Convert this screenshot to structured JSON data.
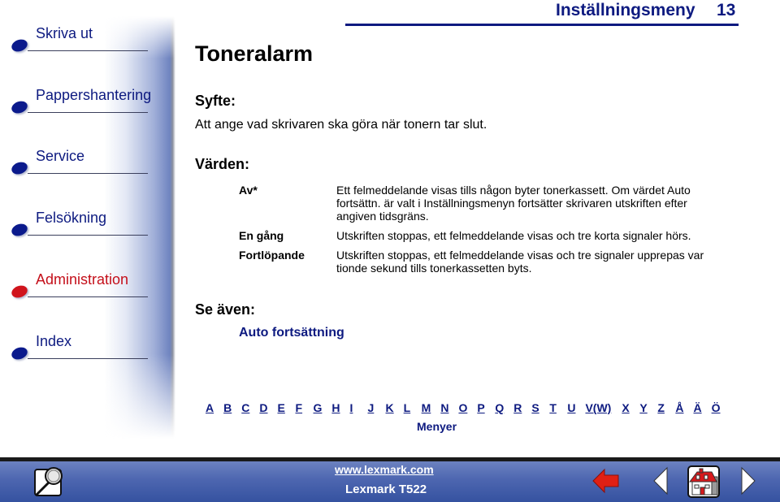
{
  "sidebar": {
    "items": [
      {
        "label": "Skriva ut",
        "active": false
      },
      {
        "label": "Pappershantering",
        "active": false
      },
      {
        "label": "Service",
        "active": false
      },
      {
        "label": "Felsökning",
        "active": false
      },
      {
        "label": "Administration",
        "active": true
      },
      {
        "label": "Index",
        "active": false
      }
    ]
  },
  "header": {
    "section": "Inställningsmeny",
    "page_number": "13"
  },
  "main": {
    "title": "Toneralarm",
    "purpose_heading": "Syfte:",
    "purpose_text": "Att ange vad skrivaren ska göra när tonern tar slut.",
    "values_heading": "Värden:",
    "values": [
      {
        "name": "Av*",
        "description": "Ett felmeddelande visas tills någon byter tonerkassett. Om värdet Auto fortsättn. är valt i Inställningsmenyn fortsätter skrivaren utskriften efter angiven tidsgräns."
      },
      {
        "name": "En gång",
        "description": "Utskriften stoppas, ett felmeddelande visas och tre korta signaler hörs."
      },
      {
        "name": "Fortlöpande",
        "description": "Utskriften stoppas, ett felmeddelande visas och tre signaler upprepas var tionde sekund tills tonerkassetten byts."
      }
    ],
    "see_also_heading": "Se även:",
    "see_also_link": "Auto fortsättning"
  },
  "alphabet": {
    "letters": [
      "A",
      "B",
      "C",
      "D",
      "E",
      "F",
      "G",
      "H",
      "I",
      "J",
      "K",
      "L",
      "M",
      "N",
      "O",
      "P",
      "Q",
      "R",
      "S",
      "T",
      "U",
      "V(W)",
      "X",
      "Y",
      "Z",
      "Å",
      "Ä",
      "Ö"
    ],
    "menus_label": "Menyer"
  },
  "footer": {
    "url": "www.lexmark.com",
    "model": "Lexmark T522",
    "icons": {
      "search": "search-icon",
      "back": "back-arrow-icon",
      "prev": "previous-page-icon",
      "home": "home-icon",
      "next": "next-page-icon"
    }
  },
  "colors": {
    "link": "#0d1a80",
    "active": "#c40f1a",
    "footer_bar": "#4d66b0"
  }
}
